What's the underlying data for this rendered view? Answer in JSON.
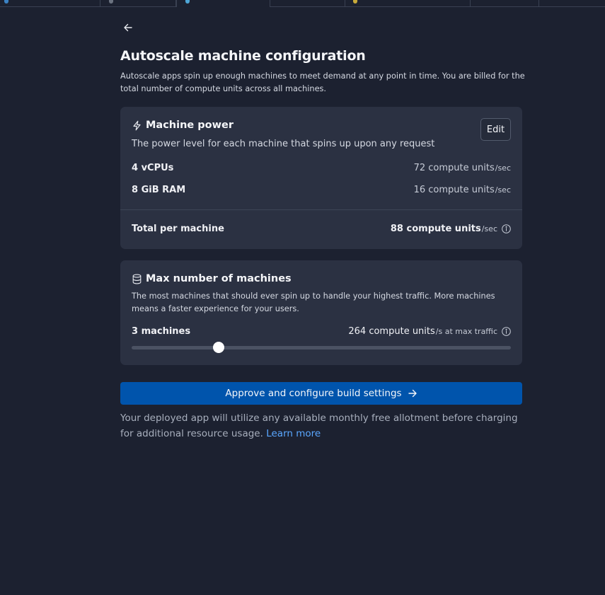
{
  "tabs": [
    {
      "label": "",
      "active": false
    },
    {
      "label": "",
      "active": false
    },
    {
      "label": "",
      "active": true
    },
    {
      "label": "",
      "active": false
    },
    {
      "label": "",
      "active": false
    },
    {
      "label": "",
      "active": false
    },
    {
      "label": "",
      "active": false
    }
  ],
  "header": {
    "back_icon": "arrow-left-icon",
    "title": "Autoscale machine configuration",
    "description": "Autoscale apps spin up enough machines to meet demand at any point in time. You are billed for the total number of compute units across all machines."
  },
  "machine_power": {
    "icon": "lightning-bolt-icon",
    "title": "Machine power",
    "subtitle": "The power level for each machine that spins up upon any request",
    "edit_label": "Edit",
    "rows": [
      {
        "label": "4 vCPUs",
        "value": "72 compute units",
        "unit": "/sec"
      },
      {
        "label": "8 GiB RAM",
        "value": "16 compute units",
        "unit": "/sec"
      }
    ],
    "total": {
      "label": "Total per machine",
      "value": "88 compute units",
      "unit": "/sec",
      "info_icon": "info-circle-icon"
    }
  },
  "max_machines": {
    "icon": "database-icon",
    "title": "Max number of machines",
    "subtitle": "The most machines that should ever spin up to handle your highest traffic. More machines means a faster experience for your users.",
    "count_label": "3 machines",
    "value": "264 compute units",
    "unit": "/s at max traffic",
    "info_icon": "info-circle-icon",
    "slider_fraction": 0.23
  },
  "actions": {
    "primary_label": "Approve and configure build settings",
    "primary_icon": "arrow-right-icon"
  },
  "footer": {
    "text": "Your deployed app will utilize any available monthly free allotment before charging for additional resource usage.",
    "link_label": "Learn more"
  },
  "colors": {
    "background": "#1c2130",
    "card": "#2b3142",
    "primary": "#0054ac",
    "link": "#5aa7ff"
  }
}
